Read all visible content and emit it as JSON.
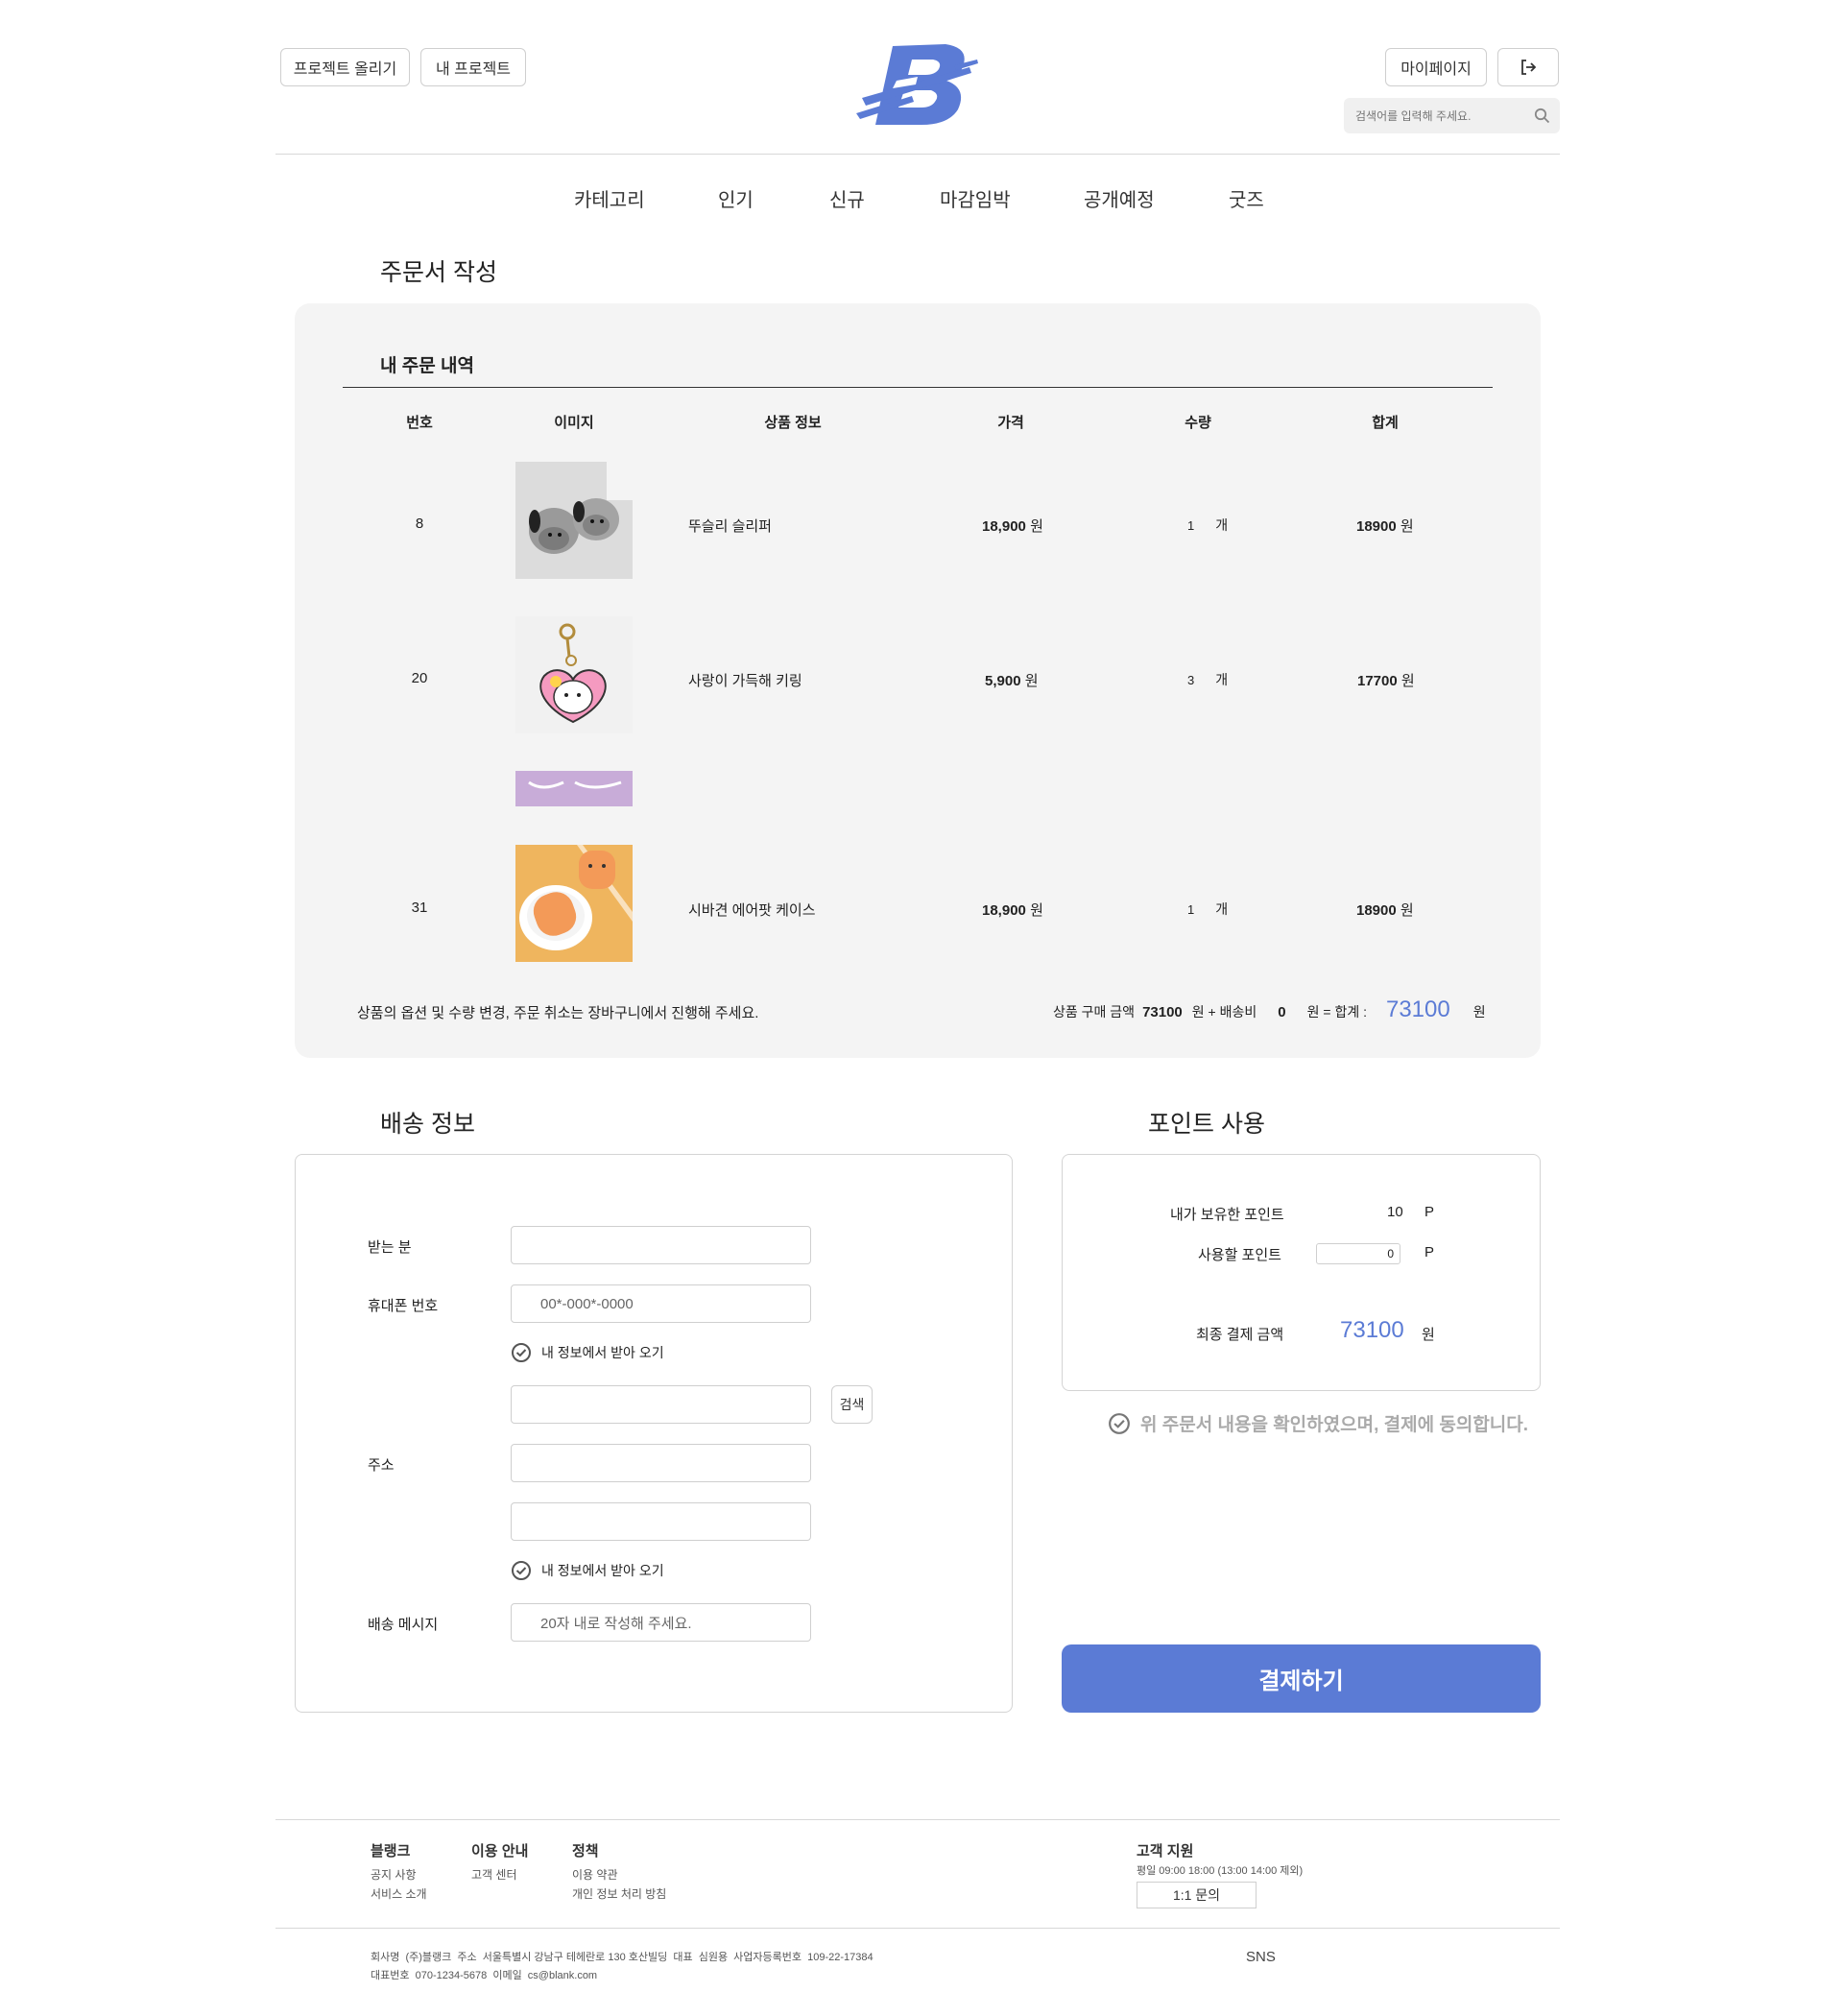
{
  "header": {
    "upload_project_label": "프로젝트 올리기",
    "my_project_label": "내 프로젝트",
    "mypage_label": "마이페이지",
    "search_placeholder": "검색어를 입력해 주세요."
  },
  "nav": [
    "카테고리",
    "인기",
    "신규",
    "마감임박",
    "공개예정",
    "굿즈"
  ],
  "page_title": "주문서 작성",
  "order": {
    "title": "내 주문 내역",
    "columns": [
      "번호",
      "이미지",
      "상품 정보",
      "가격",
      "수량",
      "합계"
    ],
    "rows": [
      {
        "no": "8",
        "name": "뚜슬리 슬리퍼",
        "price": "18,900",
        "qty": "1",
        "unit": "개",
        "total": "18900",
        "won": "원"
      },
      {
        "no": "20",
        "name": "사랑이 가득해 키링",
        "price": "5,900",
        "qty": "3",
        "unit": "개",
        "total": "17700",
        "won": "원"
      },
      {
        "no": "31",
        "name": "시바견 에어팟 케이스",
        "price": "18,900",
        "qty": "1",
        "unit": "개",
        "total": "18900",
        "won": "원"
      }
    ],
    "notice": "상품의 옵션 및 수량 변경, 주문 취소는 장바구니에서 진행해 주세요.",
    "summary": {
      "purchase_label": "상품 구매 금액",
      "purchase_amount": "73100",
      "won_plus_shipping": "원 + 배송비",
      "shipping_amount": "0",
      "won_eq_total": "원 = 합계 :",
      "total_amount": "73100",
      "won": "원"
    }
  },
  "shipping": {
    "title": "배송 정보",
    "recipient_label": "받는 분",
    "phone_label": "휴대폰 번호",
    "phone_placeholder": "00*-000*-0000",
    "load_my_info": "내 정보에서 받아 오기",
    "search_button": "검색",
    "address_label": "주소",
    "message_label": "배송 메시지",
    "message_placeholder": "20자 내로 작성해 주세요."
  },
  "points": {
    "title": "포인트 사용",
    "owned_label": "내가 보유한 포인트",
    "owned_value": "10",
    "p_unit": "P",
    "use_label": "사용할 포인트",
    "use_value": "0",
    "final_label": "최종 결제 금액",
    "final_value": "73100",
    "won": "원",
    "agree_text": "위 주문서 내용을 확인하였으며, 결제에 동의합니다.",
    "pay_button": "결제하기"
  },
  "footer": {
    "col1_title": "블랭크",
    "col1_items": [
      "공지 사항",
      "서비스 소개"
    ],
    "col2_title": "이용 안내",
    "col2_items": [
      "고객 센터"
    ],
    "col3_title": "정책",
    "col3_items": [
      "이용 약관",
      "개인 정보 처리 방침"
    ],
    "support_title": "고객 지원",
    "support_hours": "평일 09:00 18:00 (13:00 14:00 제외)",
    "inquiry_button": "1:1 문의",
    "company_line": "회사명  (주)블랭크  주소  서울특별시 강남구 테헤란로 130 호산빌딩  대표  심원용  사업자등록번호  109-22-17384",
    "contact_line": "대표번호  070-1234-5678  이메일  cs@blank.com",
    "sns": "SNS"
  },
  "colors": {
    "accent": "#5b7bd5",
    "panel_bg": "#f4f4f4"
  }
}
